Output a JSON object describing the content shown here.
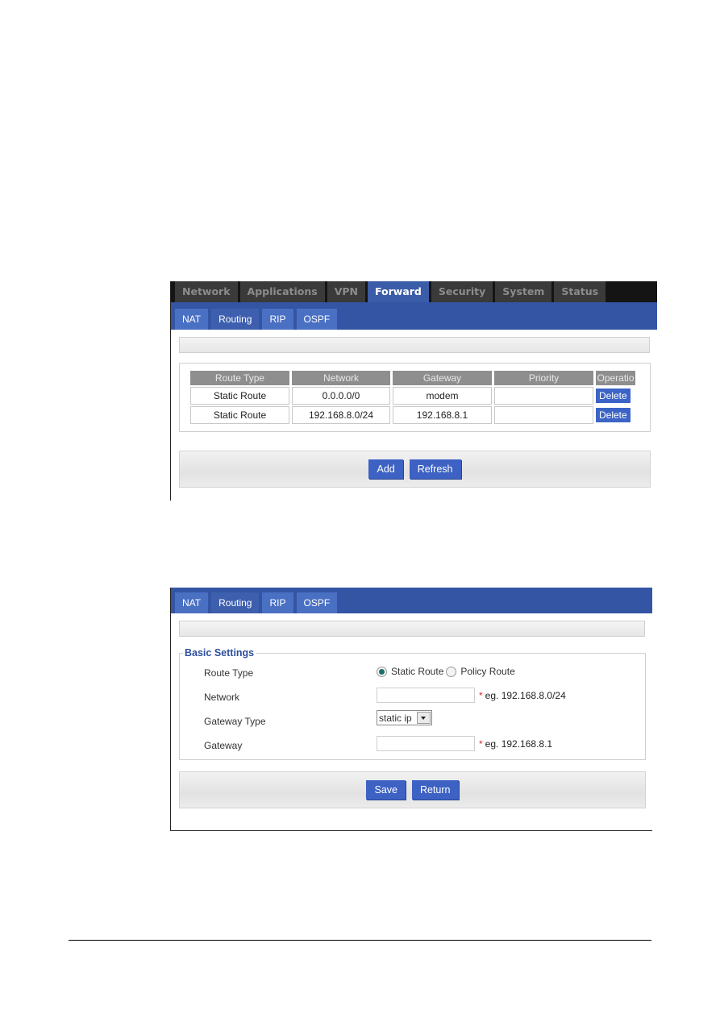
{
  "routing_list": {
    "main_tabs": [
      {
        "label": "Network",
        "active": false
      },
      {
        "label": "Applications",
        "active": false
      },
      {
        "label": "VPN",
        "active": false
      },
      {
        "label": "Forward",
        "active": true
      },
      {
        "label": "Security",
        "active": false
      },
      {
        "label": "System",
        "active": false
      },
      {
        "label": "Status",
        "active": false
      }
    ],
    "sub_tabs": [
      {
        "label": "NAT",
        "active": false
      },
      {
        "label": "Routing",
        "active": true
      },
      {
        "label": "RIP",
        "active": false
      },
      {
        "label": "OSPF",
        "active": false
      }
    ],
    "table": {
      "headers": [
        "Route Type",
        "Network",
        "Gateway",
        "Priority",
        "Operatio"
      ],
      "rows": [
        {
          "route_type": "Static Route",
          "network": "0.0.0.0/0",
          "gateway": "modem",
          "priority": "",
          "operation": "Delete"
        },
        {
          "route_type": "Static Route",
          "network": "192.168.8.0/24",
          "gateway": "192.168.8.1",
          "priority": "",
          "operation": "Delete"
        }
      ]
    },
    "buttons": {
      "add": "Add",
      "refresh": "Refresh"
    }
  },
  "routing_add": {
    "sub_tabs": [
      {
        "label": "NAT",
        "active": false
      },
      {
        "label": "Routing",
        "active": true
      },
      {
        "label": "RIP",
        "active": false
      },
      {
        "label": "OSPF",
        "active": false
      }
    ],
    "fieldset_legend": "Basic Settings",
    "fields": {
      "route_type": {
        "label": "Route Type",
        "options": [
          "Static Route",
          "Policy Route"
        ],
        "selected": "Static Route"
      },
      "network": {
        "label": "Network",
        "value": "",
        "required_mark": "*",
        "hint": "eg. 192.168.8.0/24"
      },
      "gateway_type": {
        "label": "Gateway Type",
        "selected": "static ip"
      },
      "gateway": {
        "label": "Gateway",
        "value": "",
        "required_mark": "*",
        "hint": "eg. 192.168.8.1"
      }
    },
    "buttons": {
      "save": "Save",
      "return": "Return"
    }
  },
  "colors": {
    "nav_dark": "#141414",
    "nav_blue": "#3355a4",
    "button_blue": "#3d62c4",
    "required_red": "#d9262f"
  }
}
